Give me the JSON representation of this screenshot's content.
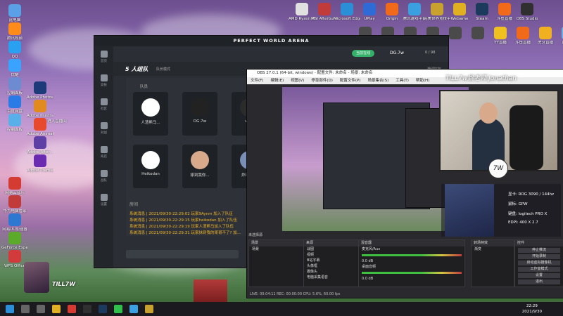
{
  "desktop": {
    "left_icons": [
      {
        "label": "此电脑",
        "color": "#5aa0e6"
      },
      {
        "label": "腾讯视频",
        "color": "#ff8c1a"
      },
      {
        "label": "QQ",
        "color": "#2aa0f0"
      },
      {
        "label": "优酷",
        "color": "#3aa3ff"
      },
      {
        "label": "控制面板",
        "color": "#6d8bd1"
      },
      {
        "label": "百度网盘",
        "color": "#2b7be6"
      },
      {
        "label": "控制面板",
        "color": "#59b0e8"
      },
      {
        "label": "Adobe Photosh...",
        "color": "#1c3b78"
      },
      {
        "label": "Adobe Illustrat...",
        "color": "#e08a20"
      },
      {
        "label": "Adobe Animate",
        "color": "#e84a2e"
      },
      {
        "label": "Adobe After...",
        "color": "#5d3fa5"
      },
      {
        "label": "Adobe Premie...",
        "color": "#6a2bb0"
      },
      {
        "label": "网易云音乐",
        "color": "#d43c33"
      },
      {
        "label": "华为电脑管家",
        "color": "#c23b3b"
      },
      {
        "label": "网易UU加速器",
        "color": "#2e78d2"
      },
      {
        "label": "GeForce Experience",
        "color": "#5caa2a"
      },
      {
        "label": "WPS Office",
        "color": "#d23b3b"
      }
    ],
    "top_icons": [
      {
        "label": "AMD Ryzen Master",
        "color": "#e0e0e0"
      },
      {
        "label": "MSI Afterburner",
        "color": "#c23b3b"
      },
      {
        "label": "Microsoft Edge",
        "color": "#2a8fd6"
      },
      {
        "label": "UPlay",
        "color": "#2f6bd6"
      },
      {
        "label": "Origin",
        "color": "#f06a1a"
      },
      {
        "label": "腾讯游戏平台",
        "color": "#3aa0e0"
      },
      {
        "label": "完美世界竞技平台",
        "color": "#c8a22e"
      },
      {
        "label": "WeGame",
        "color": "#e0b020"
      },
      {
        "label": "Steam",
        "color": "#1b3a5c"
      },
      {
        "label": "斗鱼直播",
        "color": "#f06a1a"
      },
      {
        "label": "OBS Studio",
        "color": "#303030"
      }
    ],
    "second_row_icons": [
      {
        "label": "",
        "color": "#4a4a4a"
      },
      {
        "label": "",
        "color": "#4a4a4a"
      },
      {
        "label": "",
        "color": "#4a4a4a"
      },
      {
        "label": "",
        "color": "#4a4a4a"
      },
      {
        "label": "",
        "color": "#4a4a4a"
      },
      {
        "label": "",
        "color": "#4a4a4a"
      },
      {
        "label": "YY直播",
        "color": "#f0c020"
      },
      {
        "label": "斗鱼直播",
        "color": "#f06a1a"
      },
      {
        "label": "虎牙直播",
        "color": "#f0b020"
      },
      {
        "label": "回收站",
        "color": "#6ab0e0"
      }
    ],
    "extra_label": "进入直播间"
  },
  "arena": {
    "title": "PERFECT WORLD ARENA",
    "online_pill": "当前在线",
    "user_name": "DG.7w",
    "counter": "0 / 98",
    "tab_title": "5 人组队",
    "mode_label": "队长模式",
    "invite_label": "邀请好友",
    "team_label": "队员",
    "members": [
      {
        "name": "人渣熊马...",
        "color": "#ffffff"
      },
      {
        "name": "DG.7w",
        "color": "#222222"
      },
      {
        "name": "wait",
        "color": "#2b2b2b"
      },
      {
        "name": "Heikodan",
        "color": "#ffffff"
      },
      {
        "name": "搽到我你...",
        "color": "#d8a98a"
      },
      {
        "name": "炸鸡大司",
        "color": "#7a8fb6"
      }
    ],
    "chat_header": "房间",
    "chat_messages": [
      "系统消息 | 2021/09/30-22:29:02 玩家9Aynm 加入了队伍",
      "系统消息 | 2021/09/30-22:29:15 玩家heikodan 加入了队伍",
      "系统消息 | 2021/09/30-22:29:19 玩家人渣熊马加入了队伍",
      "系统消息 | 2021/09/30-22:29:31 玩家抹到我的哥哥不了? 加..."
    ],
    "side_items": [
      "首页",
      "竞技",
      "社区",
      "对战",
      "商店",
      "战队",
      "设置"
    ]
  },
  "obs": {
    "title": "OBS 27.0.1 (64-bit, windows) - 配置文件: 未命名 - 场景: 未命名",
    "menu": [
      "文件(F)",
      "编辑(E)",
      "视图(V)",
      "停靠部件(D)",
      "配置文件(P)",
      "场景集合(S)",
      "工具(T)",
      "帮助(H)"
    ],
    "no_source": "未选择源",
    "scenes_header": "场景",
    "scenes": [
      "场景"
    ],
    "sources_header": "来源",
    "sources": [
      "战图",
      "视频",
      "B站字幕",
      "头像框",
      "摄像头",
      "电脑采集语音"
    ],
    "mixer_header": "混音器",
    "mixer": [
      {
        "name": "麦克风/Aux",
        "level": "0.0 dB"
      },
      {
        "name": "桌面音频",
        "level": "0.0 dB"
      }
    ],
    "transition_header": "转场特效",
    "transition_value": "渐变",
    "controls_header": "控件",
    "controls": [
      "停止推流",
      "开始录制",
      "启动虚拟摄像机",
      "工作室模式",
      "设置",
      "退出"
    ],
    "status": "LIVE: 00:04:11  REC: 00:00:00  CPU: 5.6%, 60.00 fps"
  },
  "overlay": {
    "tiktok_label": "TILL7w姚老师 Jonathan",
    "specs": [
      "显卡: ROG 3090 / 144hz",
      "鼠标: GPW",
      "键盘: logitech PRO X",
      "EDPI: 400 X 2.7"
    ],
    "watermark": "7W"
  },
  "stream_card": {
    "name": "TILL7W"
  },
  "taskbar": {
    "time": "22:29",
    "date": "2021/9/30",
    "apps": [
      {
        "label": "start",
        "color": "#2a8fd6"
      },
      {
        "label": "search",
        "color": "#666666"
      },
      {
        "label": "taskview",
        "color": "#666666"
      },
      {
        "label": "explorer",
        "color": "#e0b020"
      },
      {
        "label": "netease",
        "color": "#d43c33"
      },
      {
        "label": "obs",
        "color": "#303030"
      },
      {
        "label": "steam",
        "color": "#1b3a5c"
      },
      {
        "label": "wechat",
        "color": "#2fbf4a"
      },
      {
        "label": "tencent",
        "color": "#3aa0e0"
      },
      {
        "label": "arena",
        "color": "#c8a22e"
      }
    ]
  }
}
